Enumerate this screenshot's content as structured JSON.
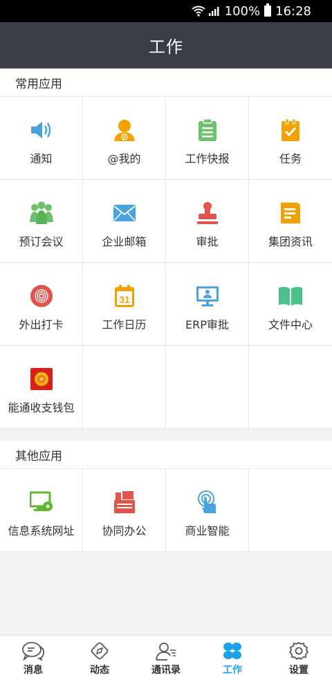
{
  "status": {
    "battery": "100%",
    "time": "16:28"
  },
  "header": {
    "title": "工作"
  },
  "common": {
    "title": "常用应用",
    "apps": [
      {
        "label": "通知",
        "icon": "speaker-icon"
      },
      {
        "label": "@我的",
        "icon": "at-me-icon"
      },
      {
        "label": "工作快报",
        "icon": "clipboard-icon"
      },
      {
        "label": "任务",
        "icon": "task-check-icon"
      },
      {
        "label": "预订会议",
        "icon": "meeting-people-icon"
      },
      {
        "label": "企业邮箱",
        "icon": "mail-icon"
      },
      {
        "label": "审批",
        "icon": "stamp-icon"
      },
      {
        "label": "集团资讯",
        "icon": "news-icon"
      },
      {
        "label": "外出打卡",
        "icon": "fingerprint-icon"
      },
      {
        "label": "工作日历",
        "icon": "calendar-icon"
      },
      {
        "label": "ERP审批",
        "icon": "erp-monitor-icon"
      },
      {
        "label": "文件中心",
        "icon": "book-icon"
      },
      {
        "label": "能通收支钱包",
        "icon": "wallet-icon"
      }
    ],
    "calendar_day": "31"
  },
  "other": {
    "title": "其他应用",
    "apps": [
      {
        "label": "信息系统网址",
        "icon": "monitor-gear-icon"
      },
      {
        "label": "协同办公",
        "icon": "printer-icon"
      },
      {
        "label": "商业智能",
        "icon": "touch-icon"
      }
    ]
  },
  "tabs": [
    {
      "label": "消息",
      "icon": "chat-icon"
    },
    {
      "label": "动态",
      "icon": "compass-icon"
    },
    {
      "label": "通讯录",
      "icon": "contacts-icon"
    },
    {
      "label": "工作",
      "icon": "clover-icon",
      "active": true
    },
    {
      "label": "设置",
      "icon": "settings-icon"
    }
  ],
  "colors": {
    "header_bg": "#3a3c47",
    "accent": "#1aa3e8"
  }
}
